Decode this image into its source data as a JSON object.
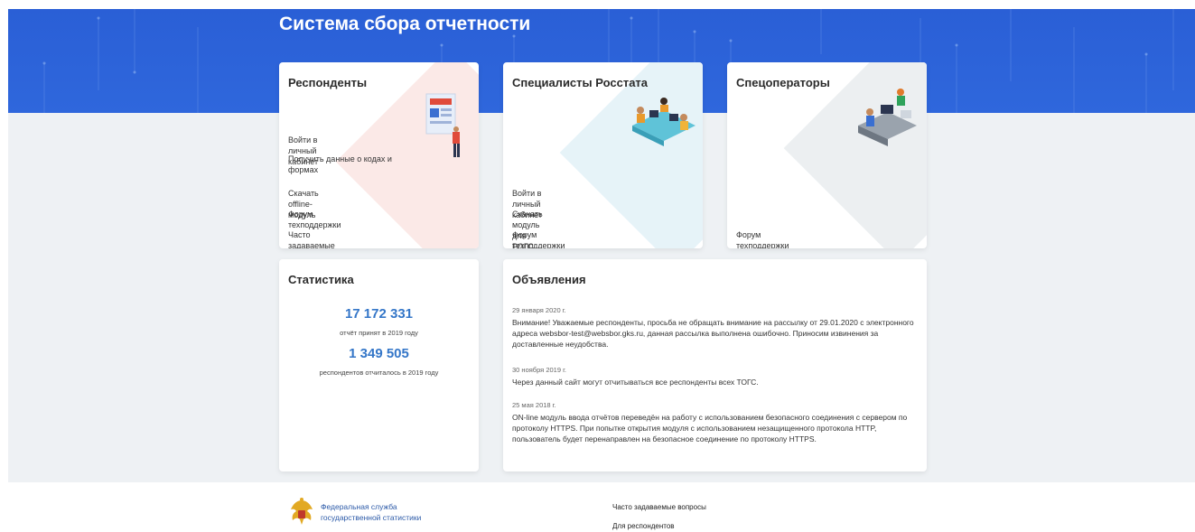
{
  "header": {
    "title": "Система сбора отчетности"
  },
  "cards": {
    "respondents": {
      "title": "Респонденты",
      "links": [
        "Войти в личный кабинет",
        "Получить данные о кодах и формах",
        "Скачать offline-модуль",
        "Форум техподдержки",
        "Часто задаваемые вопросы"
      ]
    },
    "specialists": {
      "title": "Специалисты Росстата",
      "links": [
        "Войти в личный кабинет",
        "Скачать модуль для РОГС",
        "Форум техподдержки"
      ]
    },
    "operators": {
      "title": "Спецоператоры",
      "links": [
        "Форум техподдержки"
      ]
    }
  },
  "stats": {
    "title": "Статистика",
    "reports_value": "17 172 331",
    "reports_caption": "отчёт принят в 2019 году",
    "respondents_value": "1 349 505",
    "respondents_caption": "респондентов отчиталось в 2019 году"
  },
  "announcements": {
    "title": "Объявления",
    "items": [
      {
        "date": "29 января 2020 г.",
        "text": "Внимание! Уважаемые респонденты, просьба не обращать внимание на рассылку от 29.01.2020 с электронного адреса websbor-test@websbor.gks.ru, данная рассылка выполнена ошибочно. Приносим извинения за доставленные неудобства."
      },
      {
        "date": "30 ноября 2019 г.",
        "text": "Через данный сайт могут отчитываться все респонденты всех ТОГС."
      },
      {
        "date": "25 мая 2018 г.",
        "text": "ON-line модуль ввода отчётов переведён на работу с использованием безопасного соединения с сервером по протоколу HTTPS. При попытке открытия модуля с использованием незащищенного протокола HTTP, пользователь будет перенаправлен на безопасное соединение по протоколу HTTPS."
      }
    ]
  },
  "footer": {
    "org_name": "Федеральная служба государственной статистики",
    "links": [
      "Часто задаваемые вопросы",
      "Для респондентов"
    ]
  },
  "icons": {
    "logo": "rosstat-eagle-emblem"
  },
  "colors": {
    "hero": "#2f67dc",
    "accent_number": "#3476c8",
    "page_bg": "#eef1f4"
  }
}
